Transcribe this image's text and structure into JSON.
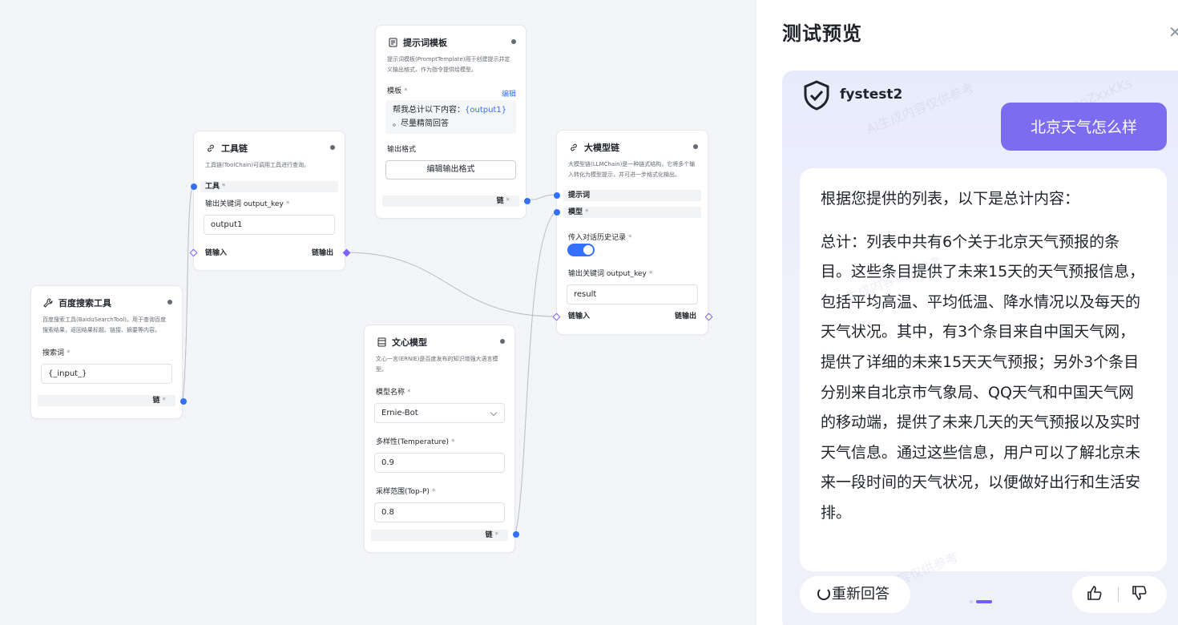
{
  "nodes": {
    "baidu": {
      "title": "百度搜索工具",
      "desc": "百度搜索工具(BaiduSearchTool)。用于查询百度搜索结果，返回结果标题、链接、摘要等内容。",
      "field_label": "搜索词",
      "field_value": "{_input_}",
      "port_label": "链"
    },
    "toolchain": {
      "title": "工具链",
      "desc": "工具链(ToolChain)可调用工具进行查询。",
      "tool_label": "工具",
      "key_label": "输出关键词 output_key",
      "key_value": "output1",
      "in_label": "链输入",
      "out_label": "链输出"
    },
    "prompt": {
      "title": "提示词模板",
      "desc": "提示词模板(PromptTemplate)用于创建提示并定义输出格式，作为指令提供给模型。",
      "tmpl_label": "模板",
      "edit_label": "编辑",
      "tmpl_text_1": "帮我总计以下内容：",
      "tmpl_var": "{output1}",
      "tmpl_text_2": "。尽量精简回答",
      "format_label": "输出格式",
      "format_button": "编辑输出格式",
      "port_label": "链"
    },
    "llmchain": {
      "title": "大模型链",
      "desc": "大模型链(LLMChain)是一种链式结构，它将多个输入转化为模型提示，并可进一步格式化输出。",
      "prompt_label": "提示词",
      "model_label": "模型",
      "history_label": "传入对话历史记录",
      "history_on": true,
      "key_label": "输出关键词 output_key",
      "key_value": "result",
      "in_label": "链输入",
      "out_label": "链输出"
    },
    "wenxin": {
      "title": "文心模型",
      "desc": "文心一言(ERNIE)是百度发布的知识增强大语言模型。",
      "name_label": "模型名称",
      "name_value": "Ernie-Bot",
      "temp_label": "多样性(Temperature)",
      "temp_value": "0.9",
      "topp_label": "采样范围(Top-P)",
      "topp_value": "0.8",
      "port_label": "链"
    }
  },
  "required_mark": "*",
  "panel": {
    "title": "测试预览",
    "close_icon": "close-icon",
    "bot_name": "fystest2",
    "user_message": "北京天气怎么样",
    "answer_para_1": "根据您提供的列表，以下是总计内容：",
    "answer_para_2": "总计：列表中共有6个关于北京天气预报的条目。这些条目提供了未来15天的天气预报信息，包括平均高温、平均低温、降水情况以及每天的天气状况。其中，有3个条目来自中国天气网，提供了详细的未来15天天气预报；另外3个条目分别来自北京市气象局、QQ天气和中国天气网的移动端，提供了未来几天的天气预报以及实时天气信息。通过这些信息，用户可以了解北京未来一段时间的天气状况，以便做好出行和生活安排。",
    "regenerate_label": "重新回答",
    "thumb_up_icon": "thumb-up-icon",
    "thumb_down_icon": "thumb-down-icon",
    "watermark_1": "aoZxxKKs",
    "watermark_2": "AI生成内容仅供参考"
  },
  "colors": {
    "accent": "#3370ff",
    "port_purple": "#7b61ff",
    "user_bubble": "#7b6cf0"
  }
}
